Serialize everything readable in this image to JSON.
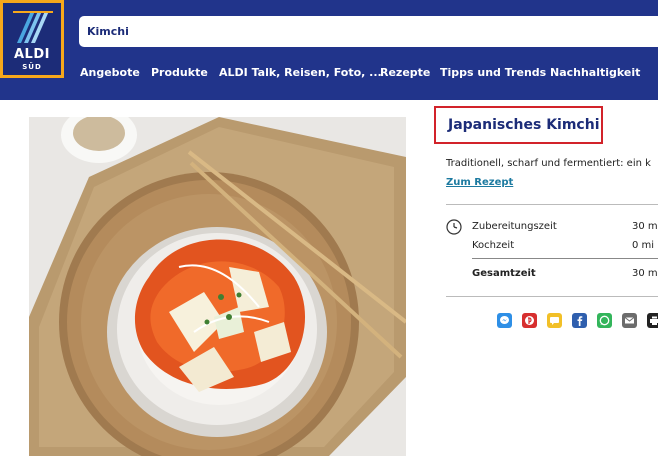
{
  "header": {
    "logo_text": "ALDI",
    "logo_sub": "SÜD",
    "search_value": "Kimchi"
  },
  "nav": {
    "items": [
      {
        "label": "Angebote"
      },
      {
        "label": "Produkte"
      },
      {
        "label": "ALDI Talk, Reisen, Foto, ..."
      },
      {
        "label": "Rezepte"
      },
      {
        "label": "Tipps und Trends"
      },
      {
        "label": "Nachhaltigkeit"
      }
    ]
  },
  "recipe": {
    "title": "Japanisches Kimchi",
    "description": "Traditionell, scharf und fermentiert: ein k",
    "link": "Zum Rezept",
    "times": {
      "prep_label": "Zubereitungszeit",
      "prep_value": "30 m",
      "cook_label": "Kochzeit",
      "cook_value": "0 mi",
      "total_label": "Gesamtzeit",
      "total_value": "30 m"
    }
  },
  "share": {
    "icons": [
      {
        "name": "messenger-icon",
        "color": "#2e8fe6"
      },
      {
        "name": "pinterest-icon",
        "color": "#d72f2f"
      },
      {
        "name": "sms-icon",
        "color": "#f2c028"
      },
      {
        "name": "facebook-icon",
        "color": "#2f5fae"
      },
      {
        "name": "whatsapp-icon",
        "color": "#33b55b"
      },
      {
        "name": "email-icon",
        "color": "#6c6c6c"
      },
      {
        "name": "print-icon",
        "color": "#222222"
      }
    ]
  },
  "colors": {
    "brand_blue": "#21348b",
    "brand_orange": "#f7a81b",
    "highlight_red": "#d2232a",
    "link_blue": "#1c7aa0"
  }
}
